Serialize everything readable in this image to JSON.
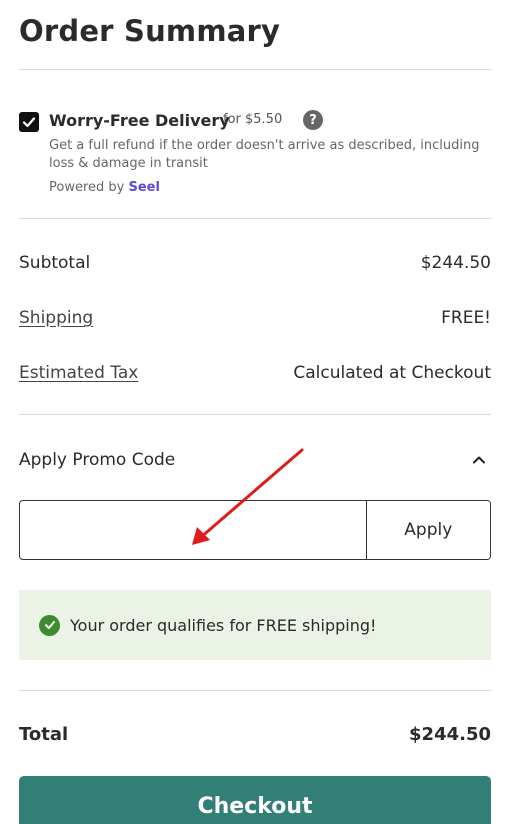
{
  "summary": {
    "title": "Order Summary"
  },
  "delivery": {
    "checked": true,
    "title": "Worry-Free Delivery",
    "price_text": "for $5.50",
    "help_glyph": "?",
    "description": "Get a full refund if the order doesn't arrive as described, including loss & damage in transit",
    "powered_prefix": "Powered by",
    "powered_brand": "Seel",
    "brand_color": "#5b4bd6"
  },
  "totals": {
    "subtotal_label": "Subtotal",
    "subtotal_value": "$244.50",
    "shipping_label": "Shipping",
    "shipping_value": "FREE!",
    "tax_label": "Estimated Tax",
    "tax_value": "Calculated at Checkout"
  },
  "promo": {
    "label": "Apply Promo Code",
    "expanded": true,
    "input_value": "",
    "apply_label": "Apply"
  },
  "notice": {
    "text": "Your order qualifies for FREE shipping!",
    "color": "#3e8a2f",
    "background": "#ebf2e6"
  },
  "order_total": {
    "label": "Total",
    "value": "$244.50"
  },
  "checkout": {
    "label": "Checkout",
    "color": "#327f78"
  },
  "annotation": {
    "arrow_color": "#e01b1b"
  }
}
